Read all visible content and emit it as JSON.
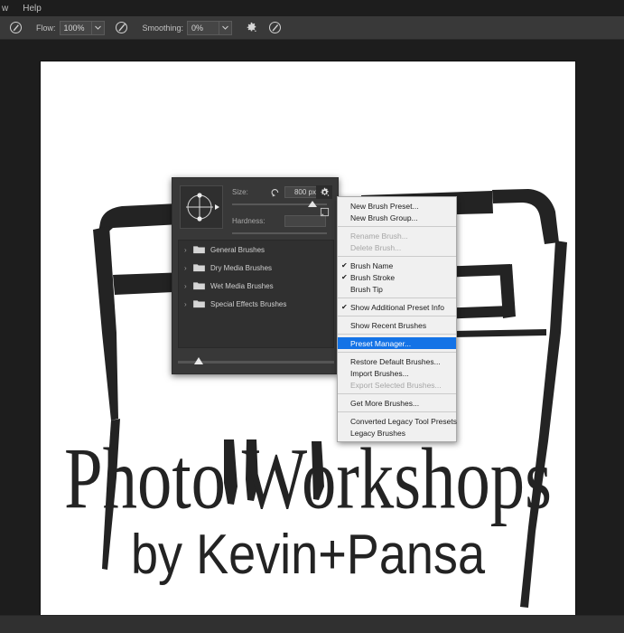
{
  "menubar": {
    "items": [
      {
        "label": "w",
        "partial": true
      },
      {
        "label": "Help",
        "partial": false
      }
    ]
  },
  "options_bar": {
    "tool_icon": "brush-tool-icon",
    "flow_label": "Flow:",
    "flow_value": "100%",
    "airbrush_icon": "airbrush-icon",
    "smoothing_label": "Smoothing:",
    "smoothing_value": "0%",
    "settings_icon": "gear-icon",
    "symmetry_icon": "symmetry-brush-icon"
  },
  "brush_panel": {
    "size_label": "Size:",
    "size_reset_icon": "reset-arrow-icon",
    "size_value": "800 px",
    "hardness_label": "Hardness:",
    "hardness_value": "",
    "gear_icon": "panel-menu-gear-icon",
    "new_group_icon": "new-group-icon",
    "groups": [
      {
        "label": "General Brushes"
      },
      {
        "label": "Dry Media Brushes"
      },
      {
        "label": "Wet Media Brushes"
      },
      {
        "label": "Special Effects Brushes"
      }
    ]
  },
  "context_menu": {
    "items": [
      {
        "label": "New Brush Preset...",
        "state": "normal",
        "checked": false
      },
      {
        "label": "New Brush Group...",
        "state": "normal",
        "checked": false
      },
      {
        "separator": true
      },
      {
        "label": "Rename Brush...",
        "state": "disabled",
        "checked": false
      },
      {
        "label": "Delete Brush...",
        "state": "disabled",
        "checked": false
      },
      {
        "separator": true
      },
      {
        "label": "Brush Name",
        "state": "normal",
        "checked": true
      },
      {
        "label": "Brush Stroke",
        "state": "normal",
        "checked": true
      },
      {
        "label": "Brush Tip",
        "state": "normal",
        "checked": false
      },
      {
        "separator": true
      },
      {
        "label": "Show Additional Preset Info",
        "state": "normal",
        "checked": true
      },
      {
        "separator": true
      },
      {
        "label": "Show Recent Brushes",
        "state": "normal",
        "checked": false
      },
      {
        "separator": true
      },
      {
        "label": "Preset Manager...",
        "state": "selected",
        "checked": false
      },
      {
        "separator": true
      },
      {
        "label": "Restore Default Brushes...",
        "state": "normal",
        "checked": false
      },
      {
        "label": "Import Brushes...",
        "state": "normal",
        "checked": false
      },
      {
        "label": "Export Selected Brushes...",
        "state": "disabled",
        "checked": false
      },
      {
        "separator": true
      },
      {
        "label": "Get More Brushes...",
        "state": "normal",
        "checked": false
      },
      {
        "separator": true
      },
      {
        "label": "Converted Legacy Tool Presets",
        "state": "normal",
        "checked": false
      },
      {
        "label": "Legacy Brushes",
        "state": "normal",
        "checked": false
      }
    ]
  },
  "canvas": {
    "headline": "Photo Workshops",
    "subline": "by Kevin+Pansa",
    "artwork_name": "camera-brush-illustration"
  },
  "colors": {
    "accent": "#1473e6",
    "panel_bg": "#383838",
    "app_bg": "#1d1d1d",
    "options_bar_bg": "#393939",
    "menu_bg": "#f0f0f0",
    "canvas_bg": "#ffffff",
    "ink": "#232323"
  }
}
